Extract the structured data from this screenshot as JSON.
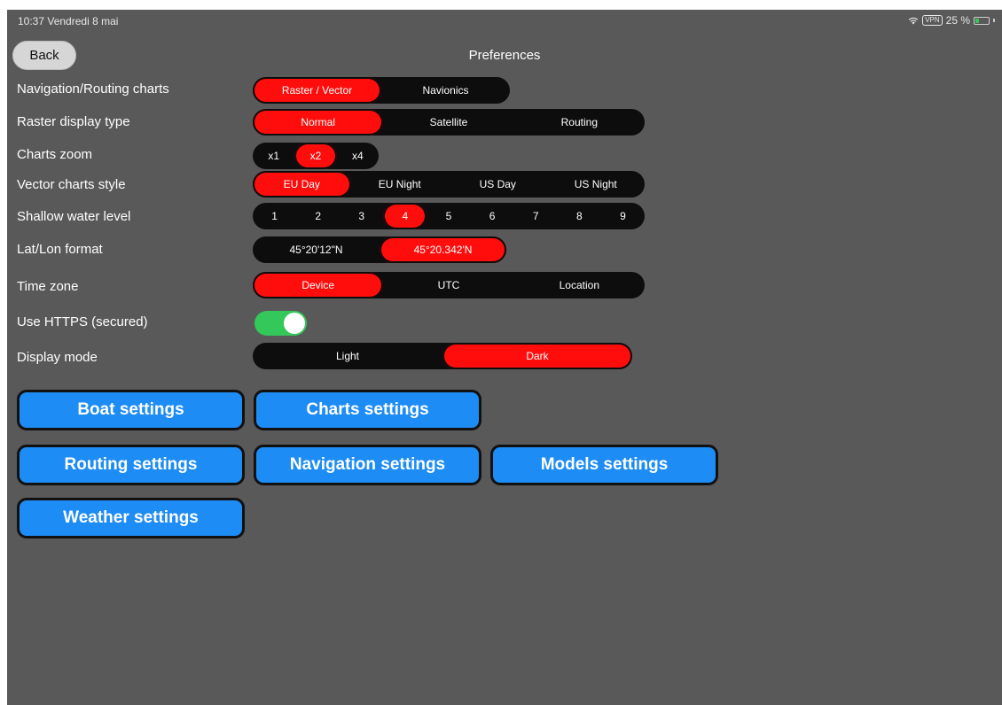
{
  "status_bar": {
    "time": "10:37  Vendredi 8 mai",
    "vpn": "VPN",
    "battery": "25 %"
  },
  "header": {
    "back_label": "Back",
    "title": "Preferences"
  },
  "settings": {
    "navigation_charts": {
      "label": "Navigation/Routing charts",
      "options": [
        "Raster / Vector",
        "Navionics"
      ],
      "selected": "Raster / Vector"
    },
    "raster_display": {
      "label": "Raster display type",
      "options": [
        "Normal",
        "Satellite",
        "Routing"
      ],
      "selected": "Normal"
    },
    "charts_zoom": {
      "label": "Charts zoom",
      "options": [
        "x1",
        "x2",
        "x4"
      ],
      "selected": "x2"
    },
    "vector_style": {
      "label": "Vector charts style",
      "options": [
        "EU Day",
        "EU Night",
        "US Day",
        "US Night"
      ],
      "selected": "EU Day"
    },
    "shallow_water": {
      "label": "Shallow water level",
      "options": [
        "1",
        "2",
        "3",
        "4",
        "5",
        "6",
        "7",
        "8",
        "9"
      ],
      "selected": "4"
    },
    "latlon_format": {
      "label": "Lat/Lon format",
      "options": [
        "45°20'12\"N",
        "45°20.342'N"
      ],
      "selected": "45°20.342'N"
    },
    "time_zone": {
      "label": "Time zone",
      "options": [
        "Device",
        "UTC",
        "Location"
      ],
      "selected": "Device"
    },
    "https": {
      "label": "Use HTTPS (secured)",
      "enabled": true
    },
    "display_mode": {
      "label": "Display mode",
      "options": [
        "Light",
        "Dark"
      ],
      "selected": "Dark"
    }
  },
  "buttons": {
    "boat": "Boat settings",
    "charts": "Charts settings",
    "routing": "Routing settings",
    "navigation": "Navigation settings",
    "models": "Models settings",
    "weather": "Weather settings"
  },
  "colors": {
    "background": "#595959",
    "selected_segment": "#ff0d0d",
    "segment_background": "#0d0d0d",
    "button_blue": "#1e8cf5",
    "toggle_on": "#34c759"
  }
}
